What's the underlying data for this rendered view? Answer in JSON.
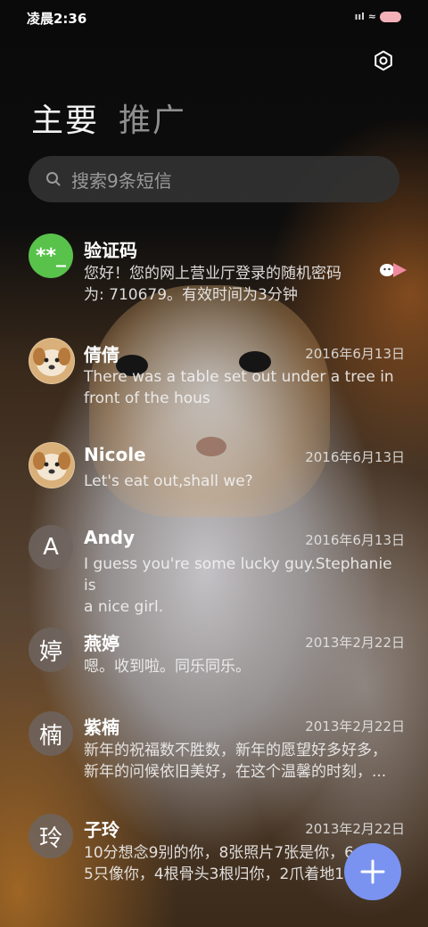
{
  "status_bar": {
    "time": "凌晨2:36",
    "signal": "ııl ≈"
  },
  "header": {
    "tabs": [
      {
        "label": "主要"
      },
      {
        "label": "推广"
      }
    ]
  },
  "search": {
    "placeholder": "搜索9条短信"
  },
  "messages": [
    {
      "sender": "验证码",
      "avatar": "**_",
      "date": "",
      "preview": [
        "您好！您的网上营业厅登录的随机密码",
        "为: 710679。有效时间为3分钟"
      ]
    },
    {
      "sender": "倩倩",
      "avatar": "dog",
      "date": "2016年6月13日",
      "preview": [
        "There was a table set out under a tree in",
        "front of the hous"
      ]
    },
    {
      "sender": "Nicole",
      "avatar": "dog",
      "date": "2016年6月13日",
      "preview": [
        "Let's eat out,shall we?"
      ]
    },
    {
      "sender": "Andy",
      "avatar": "A",
      "date": "2016年6月13日",
      "preview": [
        "I guess you're some lucky guy.Stephanie is",
        "a nice girl."
      ]
    },
    {
      "sender": "燕婷",
      "avatar": "婷",
      "date": "2013年2月22日",
      "preview": [
        "嗯。收到啦。同乐同乐。"
      ]
    },
    {
      "sender": "紫楠",
      "avatar": "楠",
      "date": "2013年2月22日",
      "preview": [
        "新年的祝福数不胜数，新年的愿望好多好多，",
        "新年的问候依旧美好，在这个温馨的时刻，..."
      ]
    },
    {
      "sender": "子玲",
      "avatar": "玲",
      "date": "2013年2月22日",
      "preview": [
        "10分想念9别的你，8张照片7张是你，6",
        "5只像你，4根骨头3根归你，2爪着地1"
      ]
    }
  ],
  "colors": {
    "fab": "#7a93f0",
    "code_avatar": "#58c24b",
    "search_bg": "#323232"
  },
  "icons": {
    "settings": "gear-icon",
    "search": "search-icon",
    "compose": "plus-icon"
  }
}
